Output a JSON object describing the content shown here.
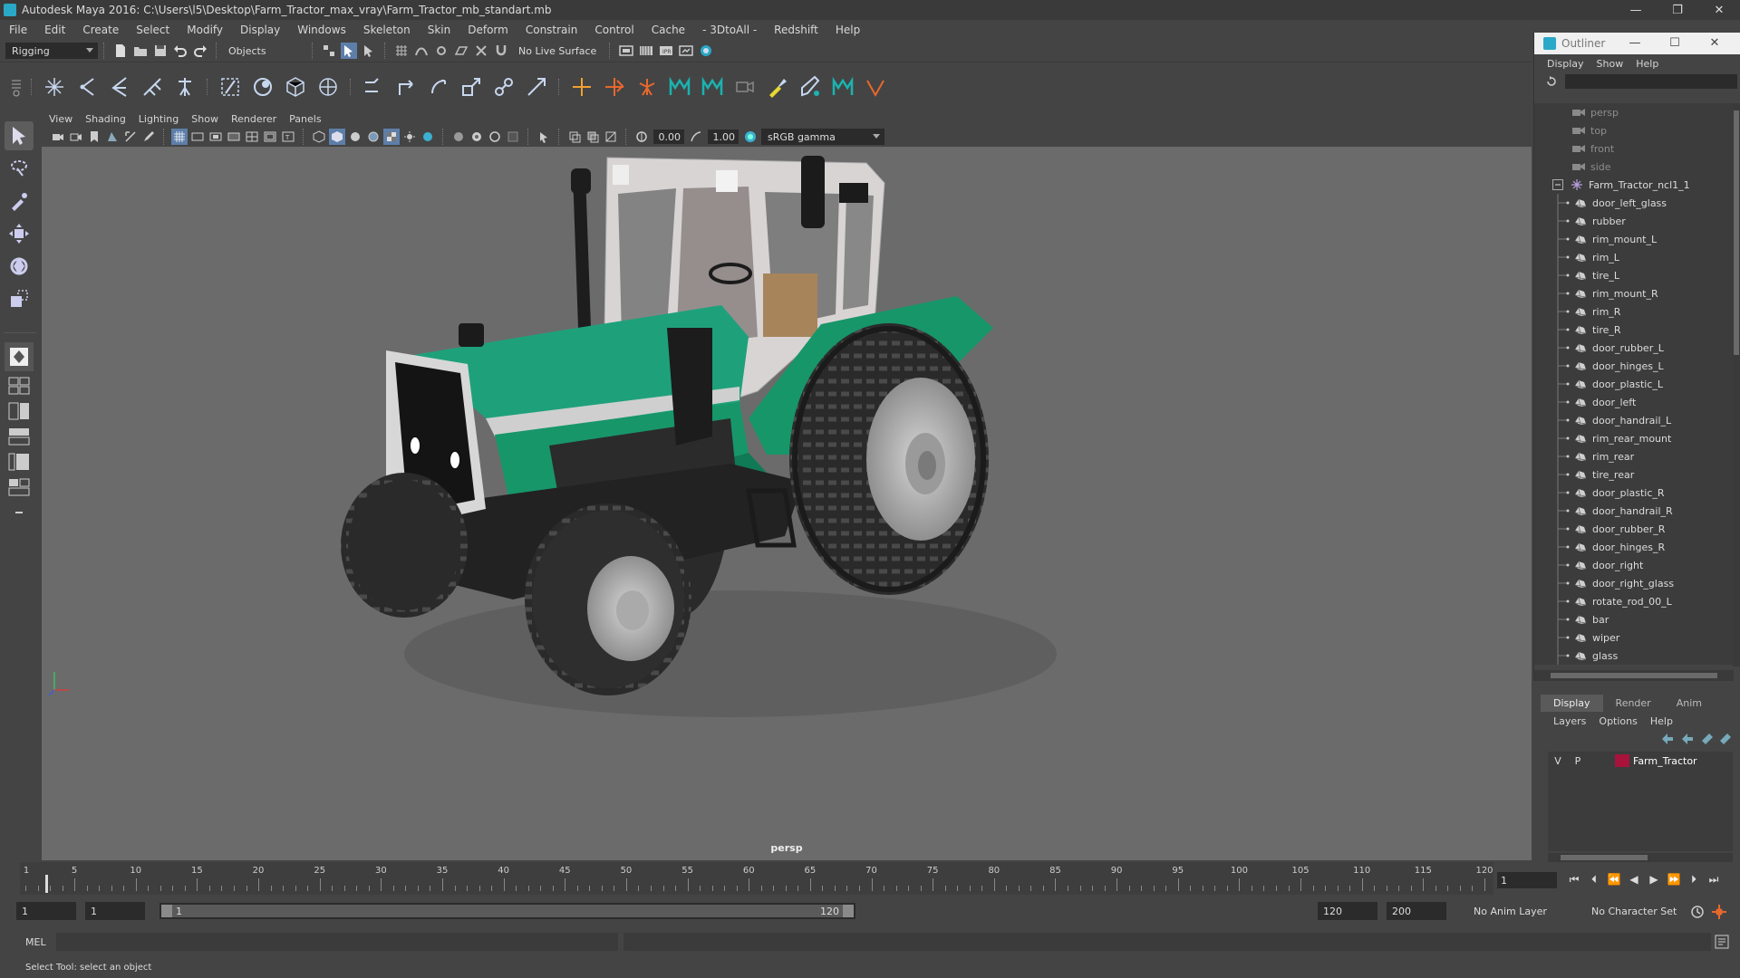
{
  "window": {
    "title": "Autodesk Maya 2016: C:\\Users\\l5\\Desktop\\Farm_Tractor_max_vray\\Farm_Tractor_mb_standart.mb",
    "controls": [
      "—",
      "❐",
      "✕"
    ]
  },
  "menubar": [
    "File",
    "Edit",
    "Create",
    "Select",
    "Modify",
    "Display",
    "Windows",
    "Skeleton",
    "Skin",
    "Deform",
    "Constrain",
    "Control",
    "Cache",
    "- 3DtoAll -",
    "Redshift",
    "Help"
  ],
  "statusline": {
    "menuset": "Rigging",
    "selection_mode": "Objects",
    "live_surface": "No Live Surface"
  },
  "viewport": {
    "menus": [
      "View",
      "Shading",
      "Lighting",
      "Show",
      "Renderer",
      "Panels"
    ],
    "near_value": "0.00",
    "far_value": "1.00",
    "color_space": "sRGB gamma",
    "camera_label": "persp"
  },
  "outliner": {
    "title": "Outliner",
    "controls": [
      "—",
      "☐",
      "✕"
    ],
    "menus": [
      "Display",
      "Show",
      "Help"
    ],
    "cameras": [
      "persp",
      "top",
      "front",
      "side"
    ],
    "group": "Farm_Tractor_ncl1_1",
    "children": [
      "door_left_glass",
      "rubber",
      "rim_mount_L",
      "rim_L",
      "tire_L",
      "rim_mount_R",
      "rim_R",
      "tire_R",
      "door_rubber_L",
      "door_hinges_L",
      "door_plastic_L",
      "door_left",
      "door_handrail_L",
      "rim_rear_mount",
      "rim_rear",
      "tire_rear",
      "door_plastic_R",
      "door_handrail_R",
      "door_rubber_R",
      "door_hinges_R",
      "door_right",
      "door_right_glass",
      "rotate_rod_00_L",
      "bar",
      "wiper",
      "glass"
    ]
  },
  "layers": {
    "tabs": [
      "Display",
      "Render",
      "Anim"
    ],
    "active_tab": "Display",
    "menus": [
      "Layers",
      "Options",
      "Help"
    ],
    "rows": [
      {
        "v": "V",
        "p": "P",
        "name": "Farm_Tractor",
        "color": "#a8123b"
      }
    ]
  },
  "timeslider": {
    "ticks": [
      "5",
      "10",
      "15",
      "20",
      "25",
      "30",
      "35",
      "40",
      "45",
      "50",
      "55",
      "60",
      "65",
      "70",
      "75",
      "80",
      "85",
      "90",
      "95",
      "100",
      "105",
      "110",
      "115",
      "120"
    ],
    "first_label": "1",
    "current_frame": "1"
  },
  "range": {
    "start": "1",
    "playback_start": "1",
    "bar_start": "1",
    "bar_end": "120",
    "playback_end": "120",
    "end": "200",
    "anim_layer": "No Anim Layer",
    "character_set": "No Character Set"
  },
  "cmdline": {
    "label": "MEL"
  },
  "helpline": "Select Tool: select an object",
  "colors": {
    "tractor_green": "#17966a",
    "viewport_bg": "#6b6b6b",
    "layer_red": "#a8123b",
    "maya_cyan": "#2aa8c7"
  }
}
